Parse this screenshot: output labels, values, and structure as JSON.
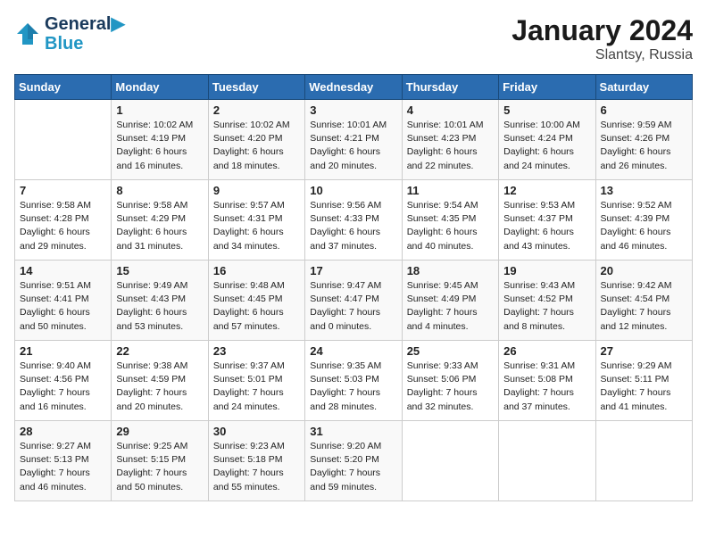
{
  "header": {
    "logo_line1": "General",
    "logo_line2": "Blue",
    "month": "January 2024",
    "location": "Slantsy, Russia"
  },
  "days_of_week": [
    "Sunday",
    "Monday",
    "Tuesday",
    "Wednesday",
    "Thursday",
    "Friday",
    "Saturday"
  ],
  "weeks": [
    [
      {
        "day": null,
        "sunrise": null,
        "sunset": null,
        "daylight": null
      },
      {
        "day": "1",
        "sunrise": "Sunrise: 10:02 AM",
        "sunset": "Sunset: 4:19 PM",
        "daylight": "Daylight: 6 hours and 16 minutes."
      },
      {
        "day": "2",
        "sunrise": "Sunrise: 10:02 AM",
        "sunset": "Sunset: 4:20 PM",
        "daylight": "Daylight: 6 hours and 18 minutes."
      },
      {
        "day": "3",
        "sunrise": "Sunrise: 10:01 AM",
        "sunset": "Sunset: 4:21 PM",
        "daylight": "Daylight: 6 hours and 20 minutes."
      },
      {
        "day": "4",
        "sunrise": "Sunrise: 10:01 AM",
        "sunset": "Sunset: 4:23 PM",
        "daylight": "Daylight: 6 hours and 22 minutes."
      },
      {
        "day": "5",
        "sunrise": "Sunrise: 10:00 AM",
        "sunset": "Sunset: 4:24 PM",
        "daylight": "Daylight: 6 hours and 24 minutes."
      },
      {
        "day": "6",
        "sunrise": "Sunrise: 9:59 AM",
        "sunset": "Sunset: 4:26 PM",
        "daylight": "Daylight: 6 hours and 26 minutes."
      }
    ],
    [
      {
        "day": "7",
        "sunrise": "Sunrise: 9:58 AM",
        "sunset": "Sunset: 4:28 PM",
        "daylight": "Daylight: 6 hours and 29 minutes."
      },
      {
        "day": "8",
        "sunrise": "Sunrise: 9:58 AM",
        "sunset": "Sunset: 4:29 PM",
        "daylight": "Daylight: 6 hours and 31 minutes."
      },
      {
        "day": "9",
        "sunrise": "Sunrise: 9:57 AM",
        "sunset": "Sunset: 4:31 PM",
        "daylight": "Daylight: 6 hours and 34 minutes."
      },
      {
        "day": "10",
        "sunrise": "Sunrise: 9:56 AM",
        "sunset": "Sunset: 4:33 PM",
        "daylight": "Daylight: 6 hours and 37 minutes."
      },
      {
        "day": "11",
        "sunrise": "Sunrise: 9:54 AM",
        "sunset": "Sunset: 4:35 PM",
        "daylight": "Daylight: 6 hours and 40 minutes."
      },
      {
        "day": "12",
        "sunrise": "Sunrise: 9:53 AM",
        "sunset": "Sunset: 4:37 PM",
        "daylight": "Daylight: 6 hours and 43 minutes."
      },
      {
        "day": "13",
        "sunrise": "Sunrise: 9:52 AM",
        "sunset": "Sunset: 4:39 PM",
        "daylight": "Daylight: 6 hours and 46 minutes."
      }
    ],
    [
      {
        "day": "14",
        "sunrise": "Sunrise: 9:51 AM",
        "sunset": "Sunset: 4:41 PM",
        "daylight": "Daylight: 6 hours and 50 minutes."
      },
      {
        "day": "15",
        "sunrise": "Sunrise: 9:49 AM",
        "sunset": "Sunset: 4:43 PM",
        "daylight": "Daylight: 6 hours and 53 minutes."
      },
      {
        "day": "16",
        "sunrise": "Sunrise: 9:48 AM",
        "sunset": "Sunset: 4:45 PM",
        "daylight": "Daylight: 6 hours and 57 minutes."
      },
      {
        "day": "17",
        "sunrise": "Sunrise: 9:47 AM",
        "sunset": "Sunset: 4:47 PM",
        "daylight": "Daylight: 7 hours and 0 minutes."
      },
      {
        "day": "18",
        "sunrise": "Sunrise: 9:45 AM",
        "sunset": "Sunset: 4:49 PM",
        "daylight": "Daylight: 7 hours and 4 minutes."
      },
      {
        "day": "19",
        "sunrise": "Sunrise: 9:43 AM",
        "sunset": "Sunset: 4:52 PM",
        "daylight": "Daylight: 7 hours and 8 minutes."
      },
      {
        "day": "20",
        "sunrise": "Sunrise: 9:42 AM",
        "sunset": "Sunset: 4:54 PM",
        "daylight": "Daylight: 7 hours and 12 minutes."
      }
    ],
    [
      {
        "day": "21",
        "sunrise": "Sunrise: 9:40 AM",
        "sunset": "Sunset: 4:56 PM",
        "daylight": "Daylight: 7 hours and 16 minutes."
      },
      {
        "day": "22",
        "sunrise": "Sunrise: 9:38 AM",
        "sunset": "Sunset: 4:59 PM",
        "daylight": "Daylight: 7 hours and 20 minutes."
      },
      {
        "day": "23",
        "sunrise": "Sunrise: 9:37 AM",
        "sunset": "Sunset: 5:01 PM",
        "daylight": "Daylight: 7 hours and 24 minutes."
      },
      {
        "day": "24",
        "sunrise": "Sunrise: 9:35 AM",
        "sunset": "Sunset: 5:03 PM",
        "daylight": "Daylight: 7 hours and 28 minutes."
      },
      {
        "day": "25",
        "sunrise": "Sunrise: 9:33 AM",
        "sunset": "Sunset: 5:06 PM",
        "daylight": "Daylight: 7 hours and 32 minutes."
      },
      {
        "day": "26",
        "sunrise": "Sunrise: 9:31 AM",
        "sunset": "Sunset: 5:08 PM",
        "daylight": "Daylight: 7 hours and 37 minutes."
      },
      {
        "day": "27",
        "sunrise": "Sunrise: 9:29 AM",
        "sunset": "Sunset: 5:11 PM",
        "daylight": "Daylight: 7 hours and 41 minutes."
      }
    ],
    [
      {
        "day": "28",
        "sunrise": "Sunrise: 9:27 AM",
        "sunset": "Sunset: 5:13 PM",
        "daylight": "Daylight: 7 hours and 46 minutes."
      },
      {
        "day": "29",
        "sunrise": "Sunrise: 9:25 AM",
        "sunset": "Sunset: 5:15 PM",
        "daylight": "Daylight: 7 hours and 50 minutes."
      },
      {
        "day": "30",
        "sunrise": "Sunrise: 9:23 AM",
        "sunset": "Sunset: 5:18 PM",
        "daylight": "Daylight: 7 hours and 55 minutes."
      },
      {
        "day": "31",
        "sunrise": "Sunrise: 9:20 AM",
        "sunset": "Sunset: 5:20 PM",
        "daylight": "Daylight: 7 hours and 59 minutes."
      },
      {
        "day": null,
        "sunrise": null,
        "sunset": null,
        "daylight": null
      },
      {
        "day": null,
        "sunrise": null,
        "sunset": null,
        "daylight": null
      },
      {
        "day": null,
        "sunrise": null,
        "sunset": null,
        "daylight": null
      }
    ]
  ]
}
